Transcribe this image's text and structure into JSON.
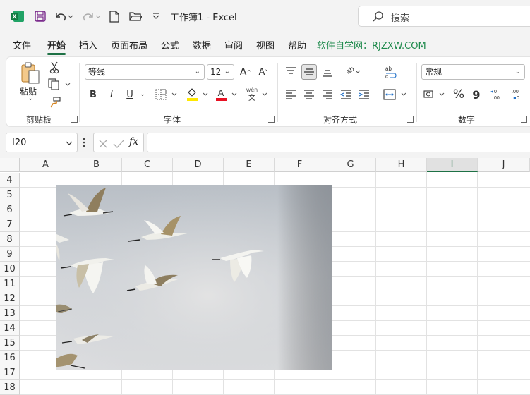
{
  "titlebar": {
    "title": "工作簿1 - Excel",
    "search_placeholder": "搜索"
  },
  "menu": {
    "items": [
      "文件",
      "开始",
      "插入",
      "页面布局",
      "公式",
      "数据",
      "审阅",
      "视图",
      "帮助",
      "软件自学网：RJZXW.COM"
    ],
    "active": "开始"
  },
  "ribbon": {
    "clipboard": {
      "label": "剪贴板",
      "paste_label": "粘贴"
    },
    "font": {
      "label": "字体",
      "font_name": "等线",
      "font_size": "12",
      "grow": "A^",
      "shrink": "Aˇ",
      "bold": "B",
      "italic": "I",
      "underline": "U",
      "phonetic_top": "wén",
      "phonetic_bottom": "文"
    },
    "alignment": {
      "label": "对齐方式",
      "wrap": "ab→c"
    },
    "number": {
      "label": "数字",
      "format": "常规",
      "percent": "%",
      "comma": "9",
      "inc_decimal": "←0 .00",
      "dec_decimal": ".00 →0"
    }
  },
  "formula_bar": {
    "name_box": "I20",
    "fx": "fx",
    "formula": ""
  },
  "sheet": {
    "columns": [
      "A",
      "B",
      "C",
      "D",
      "E",
      "F",
      "G",
      "H",
      "I",
      "J"
    ],
    "selected_column": "I",
    "rows": [
      "4",
      "5",
      "6",
      "7",
      "8",
      "9",
      "10",
      "11",
      "12",
      "13",
      "14",
      "15",
      "16",
      "17",
      "18"
    ]
  },
  "image": {
    "subject": "egrets-in-flight-photo"
  },
  "colors": {
    "excel_green": "#1e7145",
    "accent_text": "#1e8a4c"
  }
}
